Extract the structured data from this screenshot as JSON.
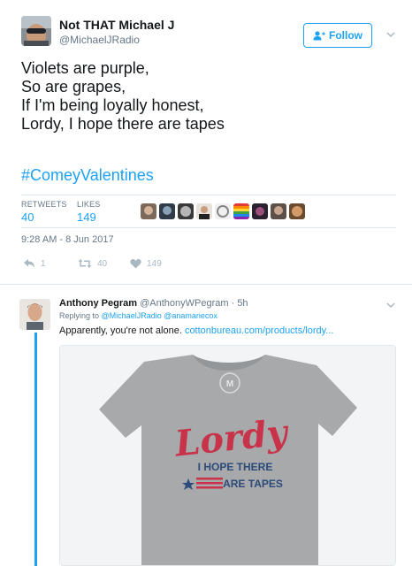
{
  "tweet": {
    "author_name": "Not THAT Michael J",
    "author_handle": "@MichaelJRadio",
    "follow_label": "Follow",
    "lines": [
      "Violets are purple,",
      "So are grapes,",
      "If I'm being loyally honest,",
      "Lordy, I hope there are tapes"
    ],
    "hashtag": "#ComeyValentines",
    "retweets_label": "RETWEETS",
    "retweets_count": "40",
    "likes_label": "LIKES",
    "likes_count": "149",
    "timestamp": "9:28 AM - 8 Jun 2017",
    "actions": {
      "reply_count": "1",
      "retweet_count": "40",
      "like_count": "149"
    }
  },
  "reply": {
    "author_name": "Anthony Pegram",
    "author_handle": "@AnthonyWPegram",
    "separator": "·",
    "time": "5h",
    "replying_prefix": "Replying to",
    "replying_to_1": "@MichaelJRadio",
    "replying_to_2": "@anamariecox",
    "text": "Apparently, you're not alone.",
    "link": "cottonbureau.com/products/lordy...",
    "shirt": {
      "badge": "M",
      "line1": "Lordy",
      "line2": "I HOPE THERE",
      "line3": "ARE TAPES"
    }
  },
  "colors": {
    "brand_blue": "#1da1f2",
    "secondary_text": "#657786",
    "shirt_grey": "#a7a9ab",
    "shirt_red": "#c8334a",
    "shirt_navy": "#2d4a7a"
  }
}
